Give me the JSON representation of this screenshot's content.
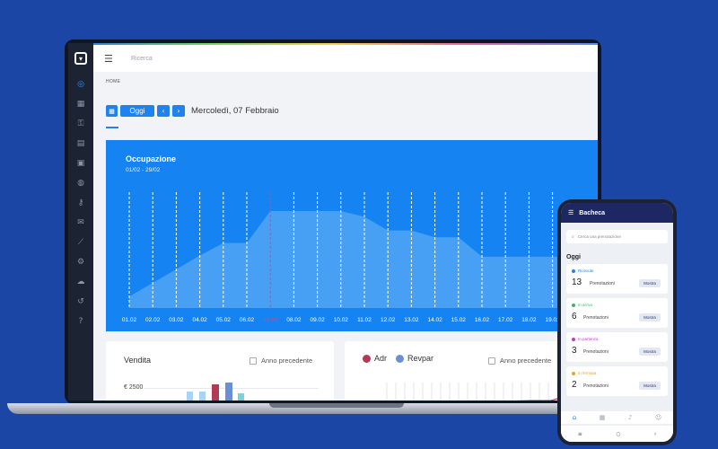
{
  "laptop": {
    "search_placeholder": "Ricerca",
    "breadcrumb": "HOME",
    "today_button": "Oggi",
    "prev_icon": "chevron-left",
    "next_icon": "chevron-right",
    "current_date": "Mercoledì, 07 Febbraio",
    "sidebar_icons": [
      "dashboard",
      "table",
      "lock",
      "document",
      "calculator",
      "bag",
      "key",
      "mail",
      "chart",
      "gear",
      "cloud",
      "history",
      "help"
    ],
    "occupancy": {
      "title": "Occupazione",
      "range": "01/02 - 29/02"
    },
    "sale_card": {
      "title": "Vendita",
      "checkbox_label": "Anno precedente",
      "axis_value": "€ 2500"
    },
    "adr_card": {
      "legend": [
        {
          "label": "Adr",
          "color": "#b23a55"
        },
        {
          "label": "Revpar",
          "color": "#6b8fd6"
        }
      ],
      "checkbox_label": "Anno precedente"
    }
  },
  "chart_data": {
    "type": "area",
    "title": "Occupazione",
    "subtitle": "01/02 - 29/02",
    "x": [
      "01.02",
      "02.02",
      "03.02",
      "04.02",
      "05.02",
      "06.02",
      "07.02",
      "08.02",
      "09.02",
      "10.02",
      "11.02",
      "12.02",
      "13.02",
      "14.02",
      "15.02",
      "16.02",
      "17.02",
      "18.02",
      "19.02"
    ],
    "values": [
      10,
      22,
      34,
      46,
      57,
      57,
      85,
      85,
      85,
      85,
      80,
      68,
      68,
      62,
      62,
      45,
      45,
      45,
      45
    ],
    "highlight_category": "07.02",
    "ylim": [
      0,
      100
    ]
  },
  "phone": {
    "title": "Bacheca",
    "search_placeholder": "Cerca una prenotazione",
    "section": "Oggi",
    "cards": [
      {
        "tag": "Ricevute",
        "tag_color": "#1e83f0",
        "count": "13",
        "label": "Prenotazioni",
        "button": "Mostra"
      },
      {
        "tag": "In arrivo",
        "tag_color": "#3cb86a",
        "count": "6",
        "label": "Prenotazioni",
        "button": "Mostra"
      },
      {
        "tag": "In partenza",
        "tag_color": "#c23ad0",
        "count": "3",
        "label": "Prenotazioni",
        "button": "Mostra"
      },
      {
        "tag": "In fermata",
        "tag_color": "#f0a030",
        "count": "2",
        "label": "Prenotazioni",
        "button": "Mostra"
      }
    ]
  }
}
